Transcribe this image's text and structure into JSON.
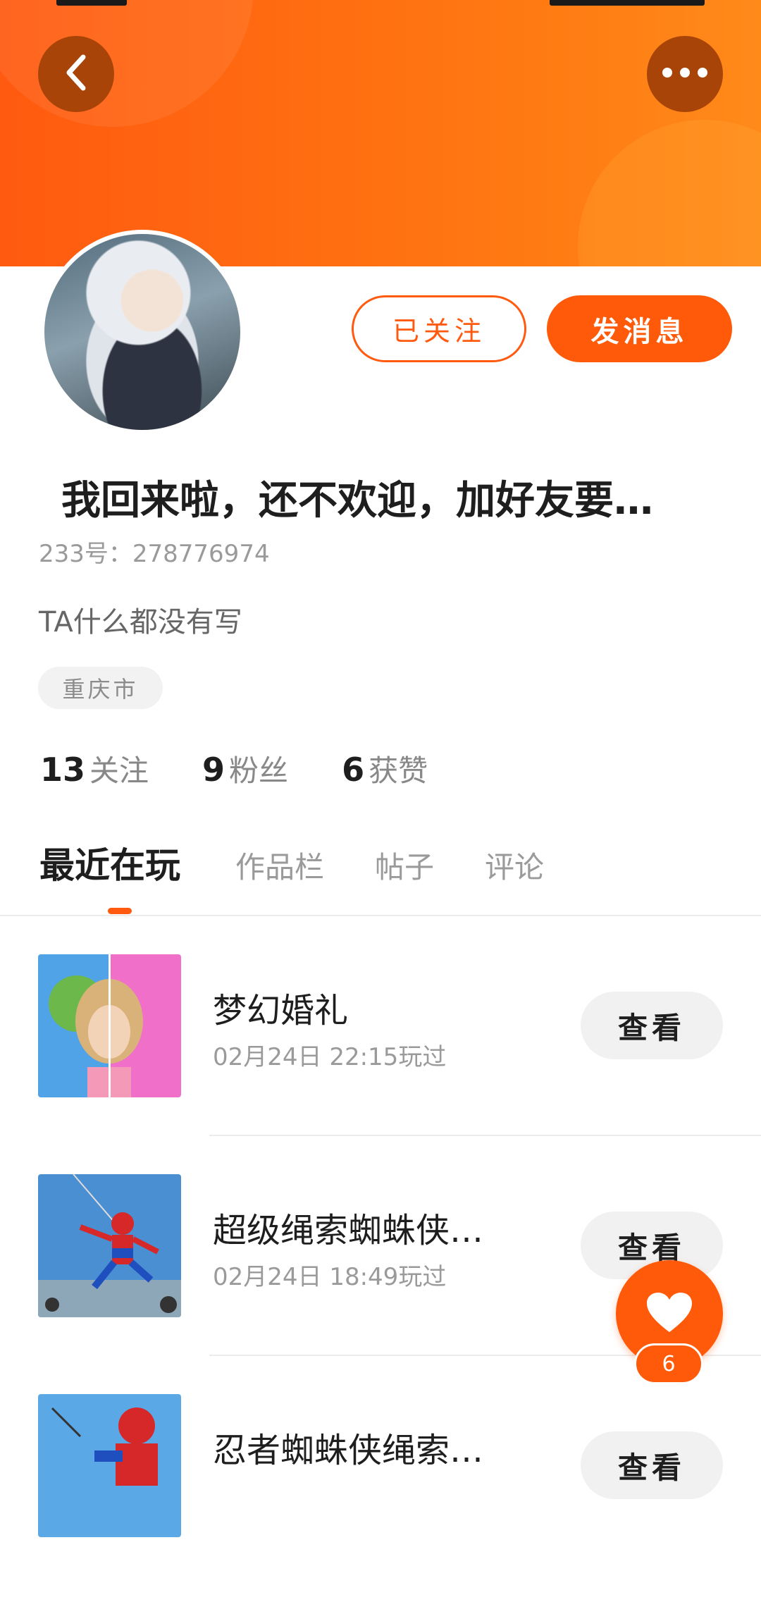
{
  "header": {
    "back_icon": "chevron-left-icon",
    "more_icon": "more-dots-icon",
    "brand_color": "#ff5a10"
  },
  "profile": {
    "follow_button": "已关注",
    "message_button": "发消息",
    "name": "我回来啦，还不欢迎，加好友要…",
    "uid": "233号：278776974",
    "bio": "TA什么都没有写",
    "location": "重庆市"
  },
  "stats": [
    {
      "count": "13",
      "label": "关注"
    },
    {
      "count": "9",
      "label": "粉丝"
    },
    {
      "count": "6",
      "label": "获赞"
    }
  ],
  "tabs": [
    {
      "label": "最近在玩",
      "active": true
    },
    {
      "label": "作品栏",
      "active": false
    },
    {
      "label": "帖子",
      "active": false
    },
    {
      "label": "评论",
      "active": false
    }
  ],
  "games": [
    {
      "name": "梦幻婚礼",
      "time": "02月24日 22:15玩过",
      "action": "查看"
    },
    {
      "name": "超级绳索蜘蛛侠：…",
      "time": "02月24日 18:49玩过",
      "action": "查看"
    },
    {
      "name": "忍者蜘蛛侠绳索英…",
      "time": "",
      "action": "查看"
    }
  ],
  "like": {
    "icon": "heart-icon",
    "count": "6"
  }
}
